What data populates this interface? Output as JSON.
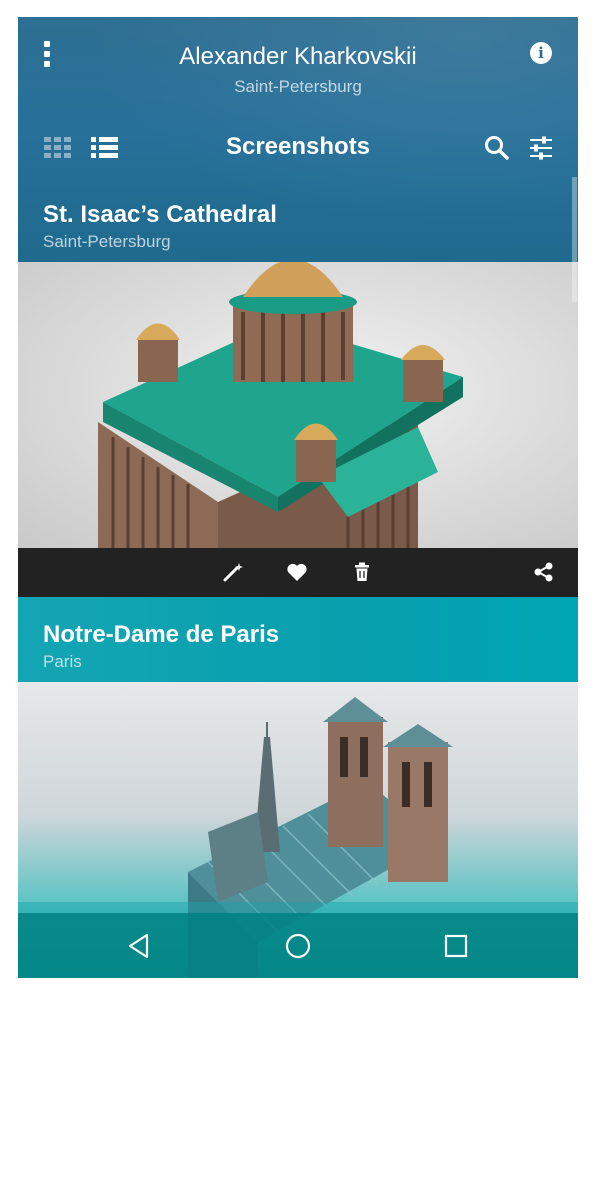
{
  "profile": {
    "name": "Alexander Kharkovskii",
    "city": "Saint-Petersburg"
  },
  "toolbar": {
    "title": "Screenshots"
  },
  "cards": [
    {
      "title": "St. Isaac’s Cathedral",
      "city": "Saint-Petersburg",
      "bg_color": "#1f6a8d"
    },
    {
      "title": "Notre-Dame de Paris",
      "city": "Paris",
      "bg_color": "#0aa2b1"
    }
  ],
  "icons": {
    "menu": "more-vertical-icon",
    "info": "info-icon",
    "grid_view": "grid-view-icon",
    "list_view": "list-view-icon",
    "search": "search-icon",
    "filter": "sliders-icon",
    "edit": "magic-wand-icon",
    "favorite": "heart-icon",
    "delete": "trash-icon",
    "share": "share-icon",
    "nav_back": "back-triangle-icon",
    "nav_home": "home-circle-icon",
    "nav_recents": "recents-square-icon"
  },
  "colors": {
    "header": "#27709a",
    "action_bar": "#222222",
    "nav_bar": "#008080"
  }
}
